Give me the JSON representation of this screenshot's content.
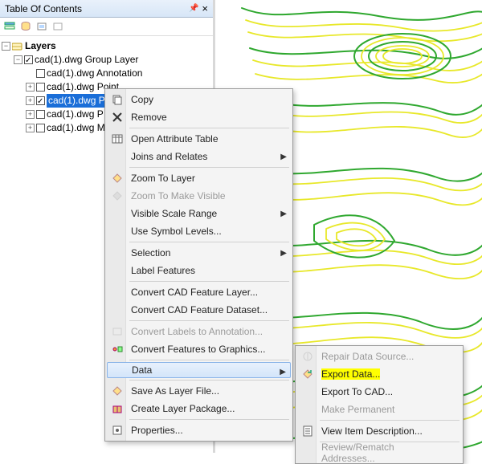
{
  "panel": {
    "title": "Table Of Contents",
    "pin_icon": "📌",
    "close_icon": "×"
  },
  "tree": {
    "root": "Layers",
    "group": "cad(1).dwg Group Layer",
    "items": [
      {
        "label": "cad(1).dwg Annotation",
        "checked": false,
        "expander": ""
      },
      {
        "label": "cad(1).dwg Point",
        "checked": false,
        "expander": "+"
      },
      {
        "label": "cad(1).dwg P",
        "checked": true,
        "expander": "+",
        "selected": true
      },
      {
        "label": "cad(1).dwg P",
        "checked": false,
        "expander": "+"
      },
      {
        "label": "cad(1).dwg M",
        "checked": false,
        "expander": "+"
      }
    ]
  },
  "context_menu": {
    "copy": "Copy",
    "remove": "Remove",
    "open_attr": "Open Attribute Table",
    "joins": "Joins and Relates",
    "zoom_layer": "Zoom To Layer",
    "zoom_visible": "Zoom To Make Visible",
    "vis_scale": "Visible Scale Range",
    "symbol_levels": "Use Symbol Levels...",
    "selection": "Selection",
    "label_feat": "Label Features",
    "conv_cad_layer": "Convert CAD Feature Layer...",
    "conv_cad_dataset": "Convert CAD Feature Dataset...",
    "conv_labels": "Convert Labels to Annotation...",
    "conv_feat_graphics": "Convert Features to Graphics...",
    "data": "Data",
    "save_layer": "Save As Layer File...",
    "create_pkg": "Create Layer Package...",
    "properties": "Properties..."
  },
  "sub_menu": {
    "repair": "Repair Data Source...",
    "export_data": "Export Data...",
    "export_cad": "Export To CAD...",
    "make_perm": "Make Permanent",
    "view_desc": "View Item Description...",
    "rematch": "Review/Rematch Addresses..."
  }
}
